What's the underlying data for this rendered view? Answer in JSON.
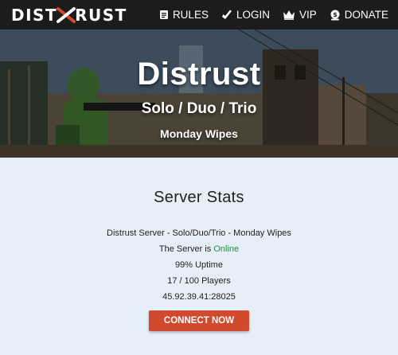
{
  "brand": {
    "left": "DIST",
    "right": "RUST"
  },
  "nav": {
    "items": [
      {
        "label": "RULES",
        "icon": "rules-icon"
      },
      {
        "label": "LOGIN",
        "icon": "login-icon"
      },
      {
        "label": "VIP",
        "icon": "crown-icon"
      },
      {
        "label": "DONATE",
        "icon": "donate-icon"
      }
    ]
  },
  "hero": {
    "title": "Distrust",
    "subtitle": "Solo / Duo / Trio",
    "wipe": "Monday Wipes"
  },
  "stats": {
    "heading": "Server Stats",
    "server_name": "Distrust Server - Solo/Duo/Trio - Monday Wipes",
    "status_prefix": "The Server is ",
    "status_value": "Online",
    "uptime": "99% Uptime",
    "players": "17 / 100 Players",
    "address": "45.92.39.41:28025",
    "connect_label": "CONNECT NOW"
  },
  "colors": {
    "accent": "#d24a2e",
    "online": "#1f8f3a",
    "nav_bg": "#1c1c1c",
    "page_bg": "#e6eff8"
  }
}
